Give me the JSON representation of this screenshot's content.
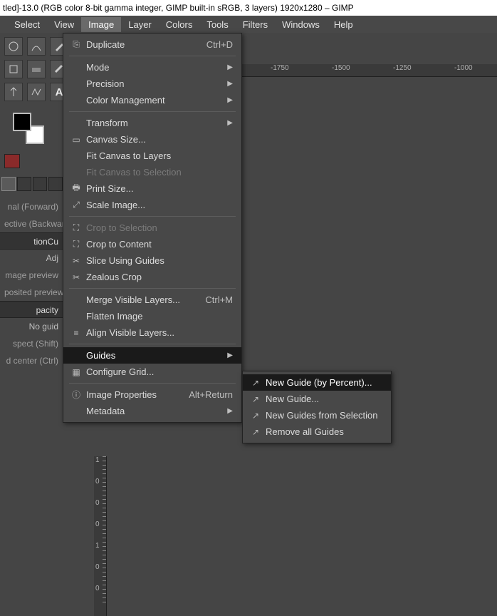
{
  "title": "tled]-13.0 (RGB color 8-bit gamma integer, GIMP built-in sRGB, 3 layers) 1920x1280 – GIMP",
  "menubar": [
    "Select",
    "View",
    "Image",
    "Layer",
    "Colors",
    "Tools",
    "Filters",
    "Windows",
    "Help"
  ],
  "menubar_open_index": 2,
  "ruler_h": [
    "-1750",
    "-1500",
    "-1250",
    "-1000"
  ],
  "ruler_v": [
    "1",
    "0",
    "0",
    "0",
    "1",
    "0",
    "0"
  ],
  "sidebar": {
    "rows": [
      {
        "text": "nal (Forward)",
        "kind": "label"
      },
      {
        "text": "ective (Backward)",
        "kind": "label"
      },
      {
        "text": "tion",
        "kind": "input",
        "right": "Cu"
      },
      {
        "text": "Adj",
        "kind": "header",
        "right": ""
      },
      {
        "text": "mage preview",
        "kind": "label"
      },
      {
        "text": "posited preview",
        "kind": "label"
      },
      {
        "text": "pacity",
        "kind": "input"
      },
      {
        "text": "No guid",
        "kind": "header"
      },
      {
        "text": "spect (Shift)",
        "kind": "label"
      },
      {
        "text": "d center (Ctrl)",
        "kind": "label"
      }
    ]
  },
  "image_menu": [
    {
      "icon": "⎘",
      "label": "Duplicate",
      "accel": "Ctrl+D"
    },
    {
      "sep": true
    },
    {
      "label": "Mode",
      "sub": true
    },
    {
      "label": "Precision",
      "sub": true
    },
    {
      "label": "Color Management",
      "sub": true
    },
    {
      "sep": true
    },
    {
      "label": "Transform",
      "sub": true
    },
    {
      "icon": "▭",
      "label": "Canvas Size..."
    },
    {
      "label": "Fit Canvas to Layers"
    },
    {
      "label": "Fit Canvas to Selection",
      "disabled": true
    },
    {
      "icon": "🖶",
      "label": "Print Size..."
    },
    {
      "icon": "⤢",
      "label": "Scale Image..."
    },
    {
      "sep": true
    },
    {
      "icon": "⛶",
      "label": "Crop to Selection",
      "disabled": true
    },
    {
      "icon": "⛶",
      "label": "Crop to Content"
    },
    {
      "icon": "✂",
      "label": "Slice Using Guides"
    },
    {
      "icon": "✂",
      "label": "Zealous Crop"
    },
    {
      "sep": true
    },
    {
      "label": "Merge Visible Layers...",
      "accel": "Ctrl+M"
    },
    {
      "label": "Flatten Image"
    },
    {
      "icon": "≡",
      "label": "Align Visible Layers..."
    },
    {
      "sep": true
    },
    {
      "label": "Guides",
      "sub": true,
      "hover": true
    },
    {
      "icon": "▦",
      "label": "Configure Grid..."
    },
    {
      "sep": true
    },
    {
      "icon": "ⓘ",
      "label": "Image Properties",
      "accel": "Alt+Return"
    },
    {
      "label": "Metadata",
      "sub": true
    }
  ],
  "guides_submenu": [
    {
      "icon": "↗",
      "label": "New Guide (by Percent)...",
      "hover": true
    },
    {
      "icon": "↗",
      "label": "New Guide..."
    },
    {
      "icon": "↗",
      "label": "New Guides from Selection"
    },
    {
      "icon": "↗",
      "label": "Remove all Guides"
    }
  ]
}
